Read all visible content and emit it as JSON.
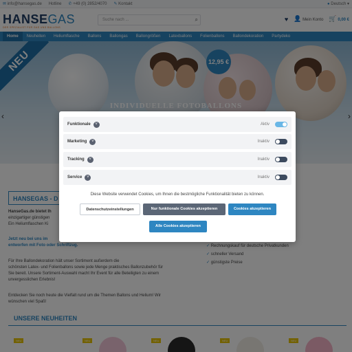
{
  "topbar": {
    "email": "info@hansegas.de",
    "hotline": "Hotline",
    "phone": "+49 (0) 2852/4070",
    "contact": "Kontakt",
    "language": "Deutsch"
  },
  "header": {
    "logo_main": "HANSE",
    "logo_accent": "GAS",
    "logo_sub": "DER SPEZIALIST FÜR GAS UND BALLONS",
    "search_placeholder": "Suche nach ...",
    "account": "Mein Konto",
    "cart_amount": "0,00 €"
  },
  "nav": {
    "items": [
      "Home",
      "Neuheiten",
      "Heliumflasche",
      "Ballons",
      "Ballongas",
      "Ballongrößen",
      "Latexballons",
      "Folienballons",
      "Ballondekoration",
      "Partydeko"
    ]
  },
  "hero": {
    "badge": "NEU",
    "price": "12,95 €",
    "title": "INDIVIDUELLE FOTOBALLONS"
  },
  "content": {
    "title": "HANSEGAS - D",
    "p1_a": "HanseGas.de bietet Ih",
    "p1_b": "einzigartiger günstigen",
    "p1_c": "Ein Heliumflaschen Ki",
    "p2_a": "Jetzt neu bei uns im",
    "p2_b": "entworfen mit Foto oder Schriftzug.",
    "p3_a": "Für Ihre Ballondekoration hält unser Sortiment außerdem die",
    "p3_b": "schönsten Latex- und Folienballons sowie jede Menge praktisches Ballonzubehör für",
    "p3_c": "Sie bereit. Unsere Sortiment-Auswahl macht Ihr Event für alle Beteiligten zu einem",
    "p3_d": "unvergesslichen Erlebnis!",
    "p4_a": "Entdecken Sie noch heute die Vielfalt rund um die Themen Ballons und Helium! Wir",
    "p4_b": "wünschen viel Spaß!",
    "checks": [
      "Rechnungskauf für deutsche Privatkunden",
      "schneller Versand",
      "günstigste Preise"
    ],
    "new_title": "UNSERE NEUHEITEN",
    "prod_tag": "NEU"
  },
  "modal": {
    "categories": [
      {
        "label": "Funktionale",
        "status": "Aktiv",
        "on": true
      },
      {
        "label": "Marketing",
        "status": "Inaktiv",
        "on": false
      },
      {
        "label": "Tracking",
        "status": "Inaktiv",
        "on": false
      },
      {
        "label": "Service",
        "status": "Inaktiv",
        "on": false
      }
    ],
    "text": "Diese Website verwendet Cookies, um Ihnen die bestmögliche Funktionalität bieten zu können.",
    "btn_settings": "Datenschutzeinstellungen",
    "btn_functional": "Nur funktionale Cookies akzeptieren",
    "btn_accept": "Cookies akzeptieren",
    "btn_accept_all": "Alle Cookies akzeptieren"
  },
  "colors": {
    "brand_blue": "#2e86c1",
    "navy": "#1f3c64",
    "toggle_off": "#3c4a5e",
    "toggle_on": "#6ab7e6"
  }
}
